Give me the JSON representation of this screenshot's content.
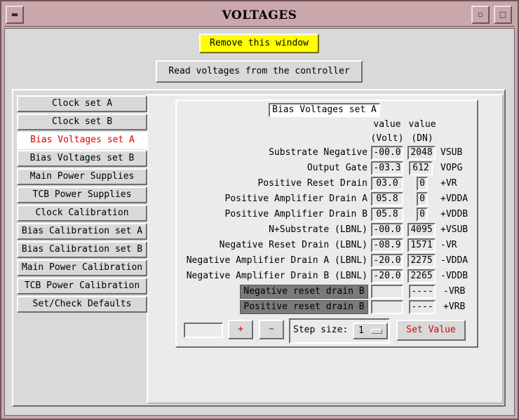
{
  "window": {
    "title": "VOLTAGES",
    "icons": {
      "menu": "minus-icon",
      "iconify": "iconify-icon",
      "maximize": "maximize-icon"
    }
  },
  "buttons": {
    "remove": "Remove this window",
    "read": "Read voltages from the controller",
    "plus": "+",
    "minus": "−",
    "set_value": "Set Value"
  },
  "colors": {
    "remove_bg": "#ffff00",
    "active_tab_text": "#e00000",
    "title_bar": "#c9a7ab"
  },
  "tabs": [
    {
      "label": "Clock set A",
      "active": false
    },
    {
      "label": "Clock set B",
      "active": false
    },
    {
      "label": "Bias Voltages set A",
      "active": true
    },
    {
      "label": "Bias Voltages set B",
      "active": false
    },
    {
      "label": "Main Power Supplies",
      "active": false
    },
    {
      "label": "TCB Power Supplies",
      "active": false
    },
    {
      "label": "Clock Calibration",
      "active": false
    },
    {
      "label": "Bias Calibration set A",
      "active": false
    },
    {
      "label": "Bias Calibration set B",
      "active": false
    },
    {
      "label": "Main Power Calibration",
      "active": false
    },
    {
      "label": "TCB Power Calibration",
      "active": false
    },
    {
      "label": "Set/Check Defaults",
      "active": false
    }
  ],
  "group": {
    "title": "Bias Voltages set A",
    "col_volt": {
      "l1": "value",
      "l2": "(Volt)"
    },
    "col_dn": {
      "l1": "value",
      "l2": "(DN)"
    }
  },
  "rows": [
    {
      "label": "Substrate Negative",
      "volt": "-00.0",
      "dn": "2048",
      "unit": "VSUB"
    },
    {
      "label": "Output Gate",
      "volt": "-03.3",
      "dn": "612",
      "unit": "VOPG"
    },
    {
      "label": "Positive Reset Drain",
      "volt": "03.0",
      "dn": "0",
      "unit": "+VR"
    },
    {
      "label": "Positive Amplifier Drain A",
      "volt": "05.8",
      "dn": "0",
      "unit": "+VDDA"
    },
    {
      "label": "Positive Amplifier Drain B",
      "volt": "05.8",
      "dn": "0",
      "unit": "+VDDB"
    },
    {
      "label": "N+Substrate (LBNL)",
      "volt": "-00.0",
      "dn": "4095",
      "unit": "+VSUB"
    },
    {
      "label": "Negative Reset Drain (LBNL)",
      "volt": "-08.9",
      "dn": "1571",
      "unit": "-VR"
    },
    {
      "label": "Negative Amplifier Drain A (LBNL)",
      "volt": "-20.0",
      "dn": "2275",
      "unit": "-VDDA"
    },
    {
      "label": "Negative Amplifier Drain B (LBNL)",
      "volt": "-20.0",
      "dn": "2265",
      "unit": "-VDDB"
    }
  ],
  "disabled_rows": [
    {
      "label": "Negative reset drain B",
      "volt": "",
      "dn": "----",
      "unit": "-VRB"
    },
    {
      "label": "Positive reset drain B",
      "volt": "",
      "dn": "----",
      "unit": "+VRB"
    }
  ],
  "controls": {
    "entry_value": "",
    "step_label": "Step size:",
    "step_value": "1"
  }
}
